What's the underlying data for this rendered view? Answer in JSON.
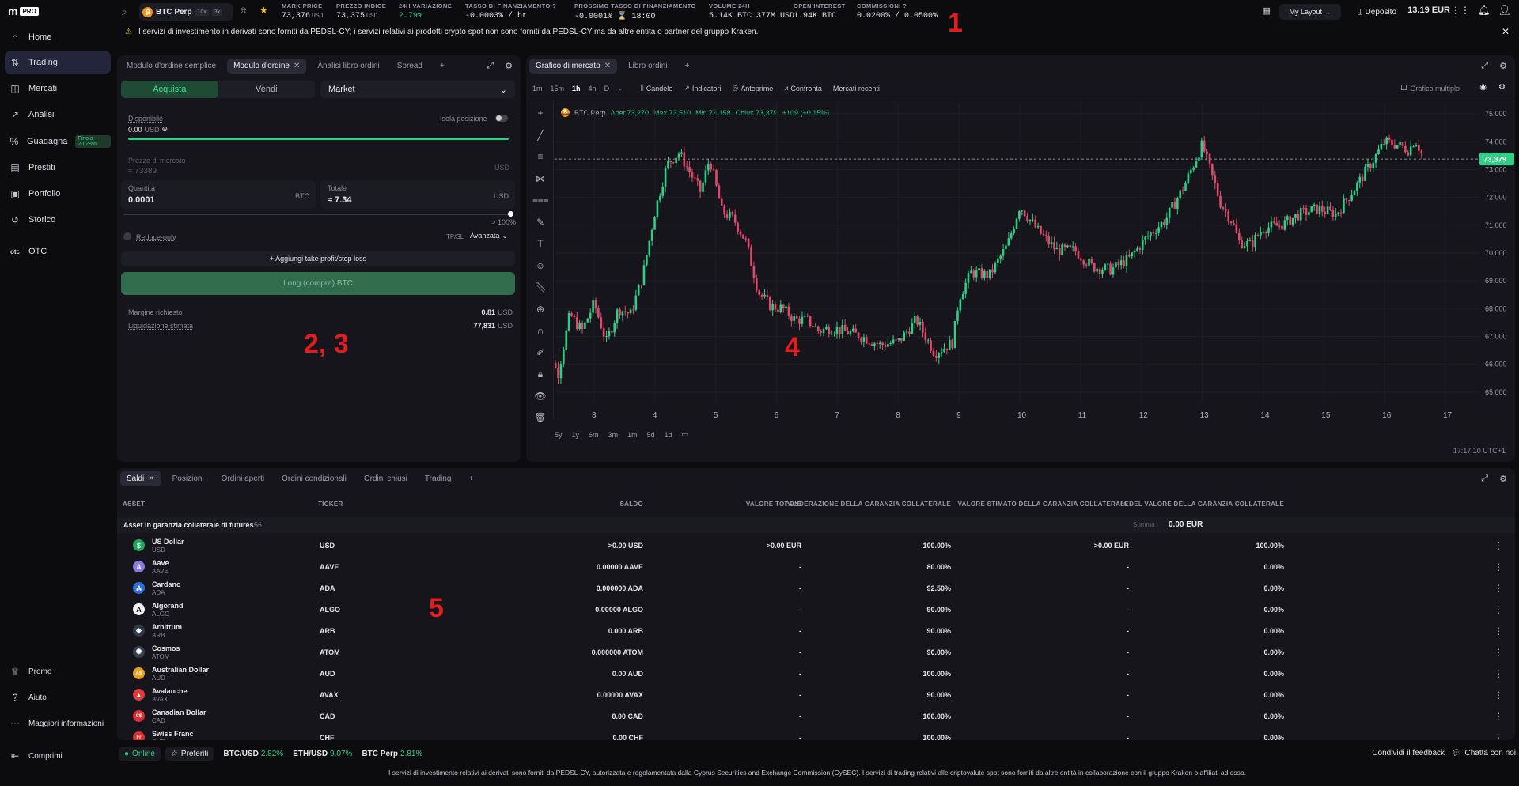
{
  "brand": {
    "logo_text": "PRO"
  },
  "sidebar": {
    "items": [
      {
        "label": "Home",
        "icon": "⌂"
      },
      {
        "label": "Trading",
        "icon": "⇅"
      },
      {
        "label": "Mercati",
        "icon": "◫"
      },
      {
        "label": "Analisi",
        "icon": "↗"
      },
      {
        "label": "Guadagna",
        "icon": "%",
        "badge": "Fino a 20,28%"
      },
      {
        "label": "Prestiti",
        "icon": "▤"
      },
      {
        "label": "Portfolio",
        "icon": "▣"
      },
      {
        "label": "Storico",
        "icon": "↺"
      },
      {
        "label": "OTC",
        "icon": "otc"
      }
    ],
    "bottom": [
      {
        "label": "Promo",
        "icon": "♕"
      },
      {
        "label": "Aiuto",
        "icon": "?"
      },
      {
        "label": "Maggiori informazioni",
        "icon": "⋯"
      },
      {
        "label": "Comprimi",
        "icon": "⇤"
      }
    ]
  },
  "topbar": {
    "pair": "BTC Perp",
    "leverage1": "10x",
    "leverage2": "3x",
    "stats": [
      {
        "label": "MARK PRICE",
        "value": "73,376",
        "unit": "USD"
      },
      {
        "label": "PREZZO INDICE",
        "value": "73,375",
        "unit": "USD"
      },
      {
        "label": "24H VARIAZIONE",
        "value": "2.79%"
      },
      {
        "label": "TASSO DI FINANZIAMENTO ?",
        "value": "-0.0003% / hr"
      },
      {
        "label": "PROSSIMO TASSO DI FINANZIAMENTO",
        "value": "-0.0001% ⌛ 18:00"
      },
      {
        "label": "VOLUME 24H",
        "value": "5.14K BTC  377M USD"
      },
      {
        "label": "OPEN INTEREST",
        "value": "1.94K BTC"
      },
      {
        "label": "COMMISSIONI ?",
        "value": "0.0200% / 0.0500%"
      }
    ],
    "layout": "My Layout",
    "deposit": "Deposito",
    "balance": "13.19 EUR"
  },
  "notice": "I servizi di investimento in derivati sono forniti da PEDSL-CY; i servizi relativi ai prodotti crypto spot non sono forniti da PEDSL-CY ma da altre entità o partner del gruppo Kraken.",
  "annotations": [
    "1",
    "2, 3",
    "4",
    "5"
  ],
  "order": {
    "tabs": [
      "Modulo d'ordine semplice",
      "Modulo d'ordine",
      "Analisi libro ordini",
      "Spread"
    ],
    "buy": "Acquista",
    "sell": "Vendi",
    "type": "Market",
    "available_label": "Disponibile",
    "available_value": "0.00",
    "available_unit": "USD",
    "isolate": "Isola posizione",
    "market_price_label": "Prezzo di mercato",
    "market_price": "≈ 73389",
    "market_price_unit": "USD",
    "qty_label": "Quantità",
    "qty": "0.0001",
    "qty_unit": "BTC",
    "total_label": "Totale",
    "total": "≈ 7.34",
    "total_unit": "USD",
    "slider_pct": "> 100%",
    "reduce_only": "Reduce-only",
    "tpsl": "TP/SL",
    "advanced": "Avanzata",
    "add_tp": "+ Aggiungi take profit/stop loss",
    "submit": "Long (compra) BTC",
    "margin_label": "Margine richiesto",
    "margin": "0.81",
    "margin_unit": "USD",
    "liq_label": "Liquidazione stimata",
    "liq": "77,831",
    "liq_unit": "USD"
  },
  "chart": {
    "tabs": [
      "Grafico di mercato",
      "Libro ordini"
    ],
    "intervals": [
      "1m",
      "15m",
      "1h",
      "4h",
      "D"
    ],
    "tools": [
      "Candele",
      "Indicatori",
      "Anteprime",
      "Confronta",
      "Mercati recenti"
    ],
    "multi": "Grafico multiplo",
    "ohlc": {
      "symbol": "BTC Perp",
      "o": "Aper.73,270",
      "h": "Max.73,510",
      "l": "Min.73,158",
      "c": "Chius.73,379",
      "chg": "+109 (+0.15%)"
    },
    "ranges": [
      "5y",
      "1y",
      "6m",
      "3m",
      "1m",
      "5d",
      "1d"
    ],
    "time": "17:17:10 UTC+1",
    "last_price": "73,379"
  },
  "chart_data": {
    "type": "candlestick",
    "xlabel": "",
    "ylabel": "",
    "x_ticks": [
      "3",
      "4",
      "5",
      "6",
      "7",
      "8",
      "9",
      "10",
      "11",
      "12",
      "13",
      "14",
      "15",
      "16",
      "17"
    ],
    "y_ticks": [
      "75,000",
      "74,000",
      "73,000",
      "72,000",
      "71,000",
      "70,000",
      "69,000",
      "68,000",
      "67,000",
      "66,000",
      "65,000"
    ],
    "ylim": [
      64600,
      75400
    ],
    "series": [
      {
        "x": [
          2.1,
          2.2,
          2.4,
          2.6,
          2.8,
          3.0,
          3.2,
          3.4,
          3.6,
          3.8,
          4.0,
          4.2,
          4.4,
          4.6,
          4.75,
          4.9,
          5.1,
          5.3,
          5.5,
          5.7,
          5.9,
          6.1,
          6.3,
          6.5,
          6.7,
          6.9,
          7.1,
          7.4,
          7.7,
          8.0,
          8.3,
          8.6,
          8.9,
          9.0,
          9.2,
          9.5,
          9.8,
          10.0,
          10.3,
          10.6,
          10.9,
          11.2,
          11.5,
          11.8,
          12.1,
          12.4,
          12.7,
          13.0,
          13.3,
          13.5,
          13.6,
          13.8,
          14.0,
          14.3,
          14.6,
          14.9,
          15.2,
          15.5,
          15.8,
          16.0,
          16.2,
          16.4,
          16.5,
          16.65
        ],
        "y": [
          66200,
          67000,
          65600,
          67800,
          67200,
          68200,
          66800,
          68000,
          67800,
          69200,
          71500,
          73200,
          73600,
          72800,
          72200,
          73400,
          71500,
          71200,
          70400,
          68600,
          68100,
          68000,
          67600,
          67600,
          67200,
          67300,
          67200,
          67000,
          66700,
          66800,
          67600,
          66400,
          66800,
          68400,
          69300,
          69200,
          70300,
          71700,
          70800,
          70100,
          70100,
          69500,
          69400,
          69800,
          70600,
          71200,
          72400,
          73900,
          71800,
          71100,
          70400,
          70300,
          70900,
          71000,
          71400,
          71600,
          71400,
          72300,
          73300,
          74000,
          73900,
          73700,
          74100,
          73379
        ]
      }
    ]
  },
  "balances": {
    "tabs": [
      "Saldi",
      "Posizioni",
      "Ordini aperti",
      "Ordini condizionali",
      "Ordini chiusi",
      "Trading"
    ],
    "headers": [
      "ASSET",
      "TICKER",
      "SALDO",
      "VALORE TOTALE",
      "PONDERAZIONE DELLA GARANZIA COLLATERALE",
      "VALORE STIMATO DELLA GARANZIA COLLATERALE",
      "% DEL VALORE DELLA GARANZIA COLLATERALE"
    ],
    "group": "Asset in garanzia collaterale di futures",
    "group_count": "56",
    "total_label": "Somma",
    "total_value": "0.00 EUR",
    "rows": [
      {
        "name": "US Dollar",
        "code": "USD",
        "ticker": "USD",
        "saldo": ">0.00 USD",
        "valore": ">0.00 EUR",
        "pond": "100.00%",
        "stim": ">0.00 EUR",
        "pct": "100.00%",
        "color": "#1fa65a",
        "sym": "$"
      },
      {
        "name": "Aave",
        "code": "AAVE",
        "ticker": "AAVE",
        "saldo": "0.00000 AAVE",
        "valore": "-",
        "pond": "80.00%",
        "stim": "-",
        "pct": "0.00%",
        "color": "#8a7be0",
        "sym": "A"
      },
      {
        "name": "Cardano",
        "code": "ADA",
        "ticker": "ADA",
        "saldo": "0.000000 ADA",
        "valore": "-",
        "pond": "92.50%",
        "stim": "-",
        "pct": "0.00%",
        "color": "#2f6fe0",
        "sym": "₳"
      },
      {
        "name": "Algorand",
        "code": "ALGO",
        "ticker": "ALGO",
        "saldo": "0.00000 ALGO",
        "valore": "-",
        "pond": "90.00%",
        "stim": "-",
        "pct": "0.00%",
        "color": "#f2f2f2",
        "sym": "A"
      },
      {
        "name": "Arbitrum",
        "code": "ARB",
        "ticker": "ARB",
        "saldo": "0.000 ARB",
        "valore": "-",
        "pond": "90.00%",
        "stim": "-",
        "pct": "0.00%",
        "color": "#2c3a4e",
        "sym": "◈"
      },
      {
        "name": "Cosmos",
        "code": "ATOM",
        "ticker": "ATOM",
        "saldo": "0.000000 ATOM",
        "valore": "-",
        "pond": "90.00%",
        "stim": "-",
        "pct": "0.00%",
        "color": "#3a3c52",
        "sym": "✺"
      },
      {
        "name": "Australian Dollar",
        "code": "AUD",
        "ticker": "AUD",
        "saldo": "0.00 AUD",
        "valore": "-",
        "pond": "100.00%",
        "stim": "-",
        "pct": "0.00%",
        "color": "#e8a020",
        "sym": "A$"
      },
      {
        "name": "Avalanche",
        "code": "AVAX",
        "ticker": "AVAX",
        "saldo": "0.00000 AVAX",
        "valore": "-",
        "pond": "90.00%",
        "stim": "-",
        "pct": "0.00%",
        "color": "#e03a3a",
        "sym": "▲"
      },
      {
        "name": "Canadian Dollar",
        "code": "CAD",
        "ticker": "CAD",
        "saldo": "0.00 CAD",
        "valore": "-",
        "pond": "100.00%",
        "stim": "-",
        "pct": "0.00%",
        "color": "#d83030",
        "sym": "C$"
      },
      {
        "name": "Swiss Franc",
        "code": "CHF",
        "ticker": "CHF",
        "saldo": "0.00 CHF",
        "valore": "-",
        "pond": "100.00%",
        "stim": "-",
        "pct": "0.00%",
        "color": "#d83030",
        "sym": "Fr"
      }
    ]
  },
  "statusbar": {
    "online": "Online",
    "fav": "Preferiti",
    "tickers": [
      {
        "pair": "BTC/USD",
        "chg": "2.82%"
      },
      {
        "pair": "ETH/USD",
        "chg": "9.07%"
      },
      {
        "pair": "BTC Perp",
        "chg": "2.81%"
      }
    ],
    "feedback": "Condividi il feedback",
    "chat": "Chatta con noi"
  },
  "footer": "I servizi di investimento relativi ai derivati sono forniti da PEDSL-CY, autorizzata e regolamentata dalla Cyprus Securities and Exchange Commission (CySEC). I servizi di trading relativi alle criptovalute spot sono forniti da altre entità in collaborazione con il gruppo Kraken o affiliati ad esso.",
  "colors": {
    "accent": "#7132f5",
    "up": "#2fcf86",
    "down": "#e24a6c",
    "buy_bg": "#1f5c3e"
  }
}
